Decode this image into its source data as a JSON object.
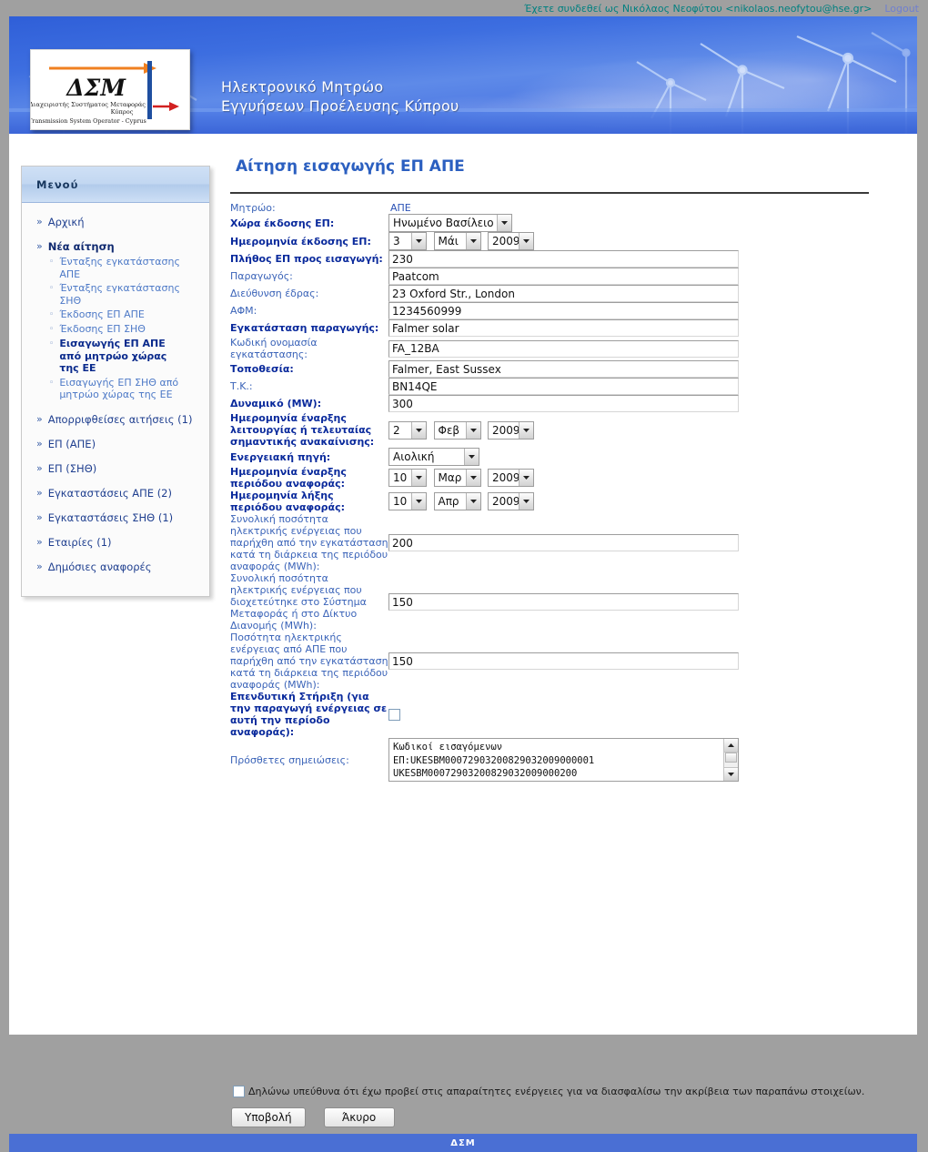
{
  "topbar": {
    "welcome": "Έχετε συνδεθεί ως Νικόλαος Νεοφύτου <nikolaos.neofytou@hse.gr>",
    "logout": "Logout"
  },
  "banner": {
    "title": "Ηλεκτρονικό Μητρώο\nΕγγυήσεων Προέλευσης Κύπρου",
    "logo": {
      "acronym": "ΔΣΜ",
      "subtitle_gr_1": "Διαχειριστής Συστήματος Μεταφοράς",
      "subtitle_gr_2": "Κύπρος",
      "subtitle_en": "Transmission System Operator - Cyprus",
      "arrow_top_color": "#f08020",
      "arrow_bottom_color": "#d22020",
      "bar_color": "#1f3f8f"
    }
  },
  "sidebar": {
    "header": "Μενού",
    "items": [
      {
        "label": "Αρχική",
        "bold": false,
        "children": []
      },
      {
        "label": "Νέα αίτηση",
        "bold": true,
        "children": [
          {
            "label": "Ένταξης εγκατάστασης ΑΠΕ",
            "bold": false
          },
          {
            "label": "Ένταξης εγκατάστασης ΣΗΘ",
            "bold": false
          },
          {
            "label": "Έκδοσης ΕΠ ΑΠΕ",
            "bold": false
          },
          {
            "label": "Έκδοσης ΕΠ ΣΗΘ",
            "bold": false
          },
          {
            "label": "Εισαγωγής ΕΠ ΑΠΕ από μητρώο χώρας της ΕΕ",
            "bold": true
          },
          {
            "label": "Εισαγωγής ΕΠ ΣΗΘ από μητρώο χώρας της ΕΕ",
            "bold": false
          }
        ]
      },
      {
        "label": "Απορριφθείσες αιτήσεις (1)",
        "bold": false,
        "children": []
      },
      {
        "label": "ΕΠ (ΑΠΕ)",
        "bold": false,
        "children": []
      },
      {
        "label": "ΕΠ (ΣΗΘ)",
        "bold": false,
        "children": []
      },
      {
        "label": "Εγκαταστάσεις ΑΠΕ (2)",
        "bold": false,
        "children": []
      },
      {
        "label": "Εγκαταστάσεις ΣΗΘ (1)",
        "bold": false,
        "children": []
      },
      {
        "label": "Εταιρίες (1)",
        "bold": false,
        "children": []
      },
      {
        "label": "Δημόσιες αναφορές",
        "bold": false,
        "children": []
      }
    ]
  },
  "form": {
    "title": "Αίτηση εισαγωγής ΕΠ ΑΠΕ",
    "registry": {
      "label": "Μητρώο:",
      "value": "ΑΠΕ"
    },
    "country": {
      "label": "Χώρα έκδοσης ΕΠ:",
      "value": "Ηνωμένο Βασίλειο"
    },
    "issue_date": {
      "label": "Ημερομηνία έκδοσης ΕΠ:",
      "day": "3",
      "month": "Μάι",
      "year": "2009"
    },
    "count": {
      "label": "Πλήθος ΕΠ προς εισαγωγή:",
      "value": "230"
    },
    "producer": {
      "label": "Παραγωγός:",
      "value": "Paatcom"
    },
    "address": {
      "label": "Διεύθυνση έδρας:",
      "value": "23 Oxford Str., London"
    },
    "vat": {
      "label": "ΑΦΜ:",
      "value": "1234560999"
    },
    "installation": {
      "label": "Εγκατάσταση παραγωγής:",
      "value": "Falmer solar"
    },
    "code_name": {
      "label": "Κωδική ονομασία εγκατάστασης:",
      "value": "FA_12BA"
    },
    "location": {
      "label": "Τοποθεσία:",
      "value": "Falmer, East Sussex"
    },
    "postcode": {
      "label": "Τ.Κ.:",
      "value": "BN14QE"
    },
    "capacity": {
      "label": "Δυναμικό (MW):",
      "value": "300"
    },
    "operation_date": {
      "label": "Ημερομηνία έναρξης λειτουργίας ή τελευταίας σημαντικής ανακαίνισης:",
      "day": "2",
      "month": "Φεβ",
      "year": "2009"
    },
    "energy_source": {
      "label": "Ενεργειακή πηγή:",
      "value": "Αιολική"
    },
    "period_start": {
      "label": "Ημερομηνία έναρξης περιόδου αναφοράς:",
      "day": "10",
      "month": "Μαρ",
      "year": "2009"
    },
    "period_end": {
      "label": "Ημερομηνία λήξης περιόδου αναφοράς:",
      "day": "10",
      "month": "Απρ",
      "year": "2009"
    },
    "total_produced": {
      "label": "Συνολική ποσότητα ηλεκτρικής ενέργειας που παρήχθη από την εγκατάσταση κατά τη διάρκεια της περιόδου αναφοράς (MWh):",
      "value": "200"
    },
    "total_injected": {
      "label": "Συνολική ποσότητα ηλεκτρικής ενέργειας που διοχετεύτηκε στο Σύστημα Μεταφοράς ή στο Δίκτυο Διανομής (MWh):",
      "value": "150"
    },
    "res_produced": {
      "label": "Ποσότητα ηλεκτρικής ενέργειας από ΑΠΕ που παρήχθη από την εγκατάσταση κατά τη διάρκεια της περιόδου αναφοράς (MWh):",
      "value": "150"
    },
    "investment_support": {
      "label": "Επενδυτική Στήριξη (για την παραγωγή ενέργειας σε αυτή την περίοδο αναφοράς):",
      "checked": false
    },
    "notes": {
      "label": "Πρόσθετες σημειώσεις:",
      "value": "Κωδικοί εισαγόμενων\nΕΠ:UKESBM00072903200829032009000001\nUKESBM00072903200829032009000200"
    }
  },
  "declaration": {
    "text": "Δηλώνω υπεύθυνα ότι έχω προβεί στις απαραίτητες ενέργειες για να διασφαλίσω την ακρίβεια των παραπάνω στοιχείων.",
    "checked": false
  },
  "buttons": {
    "submit": "Υποβολή",
    "cancel": "Άκυρο"
  },
  "footer": {
    "text": "ΔΣΜ"
  }
}
